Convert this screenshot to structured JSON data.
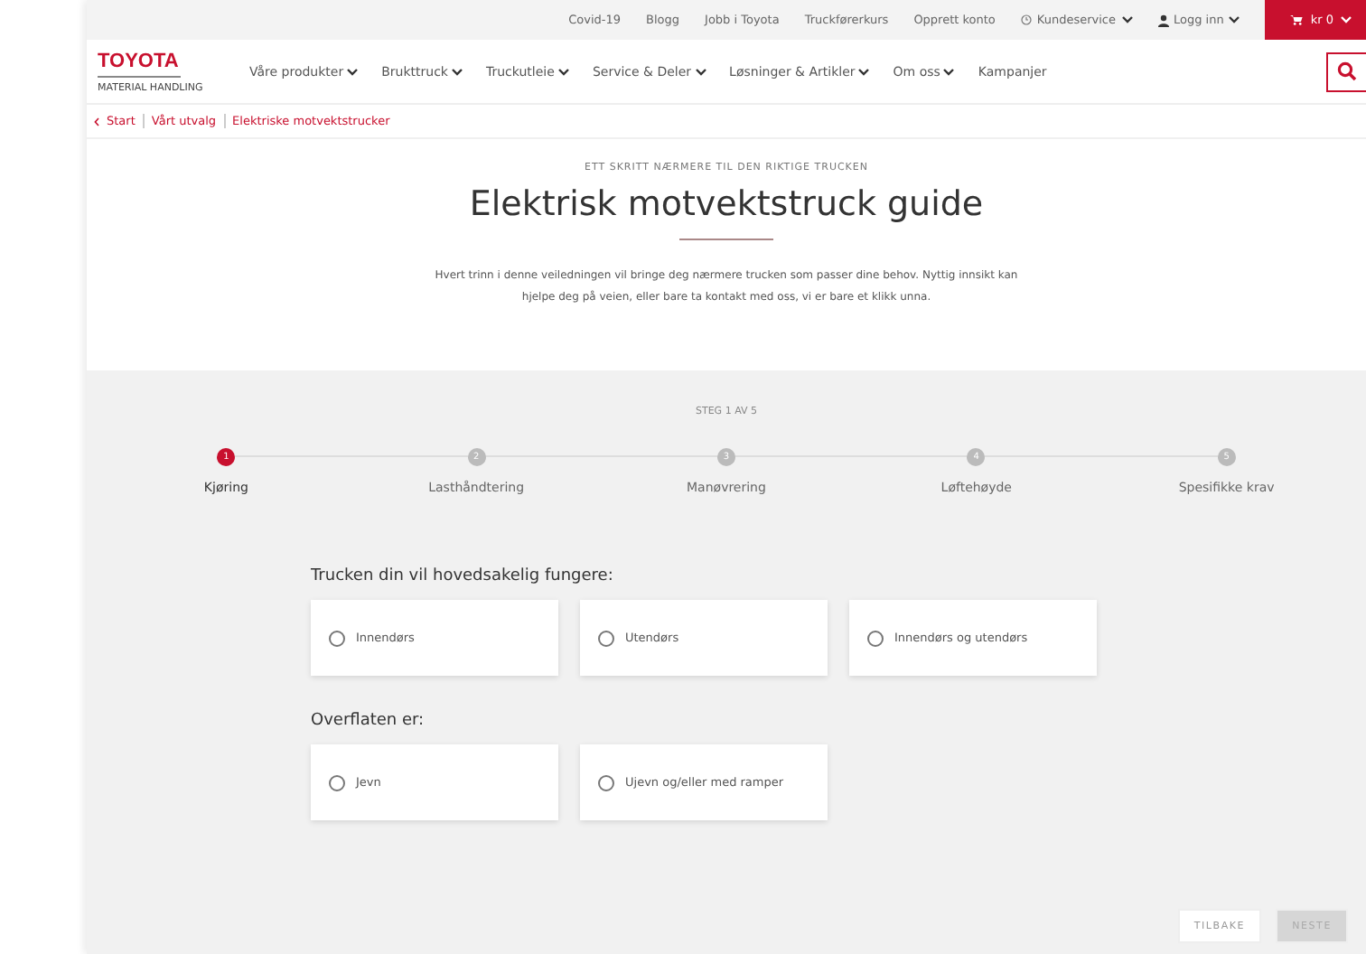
{
  "top_links": [
    "Covid-19",
    "Blogg",
    "Jobb i Toyota",
    "Truckførerkurs",
    "Opprett konto"
  ],
  "customer_service": "Kundeservice",
  "login": "Logg inn",
  "cart": "kr 0",
  "logo": {
    "brand": "TOYOTA",
    "sub": "MATERIAL HANDLING"
  },
  "nav": [
    {
      "label": "Våre produkter",
      "dropdown": true
    },
    {
      "label": "Brukttruck",
      "dropdown": true
    },
    {
      "label": "Truckutleie",
      "dropdown": true
    },
    {
      "label": "Service & Deler",
      "dropdown": true
    },
    {
      "label": "Løsninger & Artikler",
      "dropdown": true
    },
    {
      "label": "Om oss",
      "dropdown": true
    },
    {
      "label": "Kampanjer",
      "dropdown": false
    }
  ],
  "breadcrumb": [
    "Start",
    "Vårt utvalg",
    "Elektriske motvektstrucker"
  ],
  "eyebrow": "ETT SKRITT NÆRMERE TIL DEN RIKTIGE TRUCKEN",
  "title": "Elektrisk motvektstruck guide",
  "intro": "Hvert trinn i denne veiledningen vil bringe deg nærmere trucken som passer dine behov. Nyttig innsikt kan hjelpe deg på veien, eller bare ta kontakt med oss, vi er bare et klikk unna.",
  "step_counter": "STEG 1 AV 5",
  "steps": [
    {
      "number": "1",
      "label": "Kjøring",
      "selected": true
    },
    {
      "number": "2",
      "label": "Lasthåndtering",
      "selected": false
    },
    {
      "number": "3",
      "label": "Manøvrering",
      "selected": false
    },
    {
      "number": "4",
      "label": "Løftehøyde",
      "selected": false
    },
    {
      "number": "5",
      "label": "Spesifikke krav",
      "selected": false
    }
  ],
  "questions": [
    {
      "question": "Trucken din vil hovedsakelig fungere:",
      "options": [
        {
          "label": "Innendørs",
          "selected": false
        },
        {
          "label": "Utendørs",
          "selected": false
        },
        {
          "label": "Innendørs og utendørs",
          "selected": false
        }
      ]
    },
    {
      "question": "Overflaten er:",
      "options": [
        {
          "label": "Jevn",
          "selected": false
        },
        {
          "label": "Ujevn og/eller med ramper",
          "selected": false
        }
      ]
    }
  ],
  "buttons": [
    {
      "label": "TILBAKE",
      "disabled": false
    },
    {
      "label": "NESTE",
      "disabled": true
    }
  ]
}
